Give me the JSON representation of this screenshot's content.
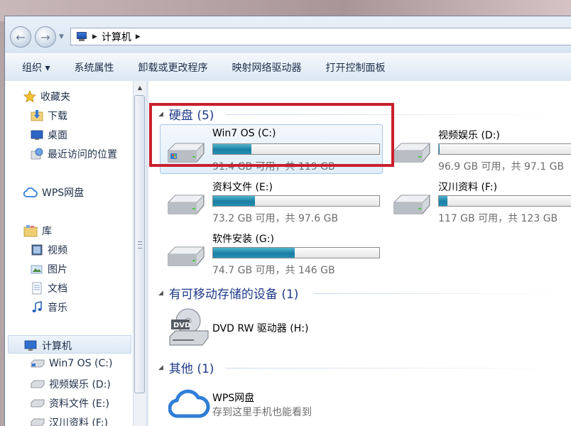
{
  "address": {
    "path": "计算机"
  },
  "toolbar": {
    "organize": "组织 ▾",
    "system_properties": "系统属性",
    "uninstall": "卸载或更改程序",
    "map_drive": "映射网络驱动器",
    "control_panel": "打开控制面板"
  },
  "nav": {
    "favorites": "收藏夹",
    "downloads": "下载",
    "desktop": "桌面",
    "recent": "最近访问的位置",
    "wps": "WPS网盘",
    "libraries": "库",
    "videos": "视频",
    "pictures": "图片",
    "documents": "文档",
    "music": "音乐",
    "computer": "计算机",
    "drive_c": "Win7 OS (C:)",
    "drive_d": "视频娱乐 (D:)",
    "drive_e": "资料文件 (E:)",
    "drive_f": "汉川资料 (F:)"
  },
  "groups": {
    "hdd": "硬盘 (5)",
    "removable": "有可移动存储的设备 (1)",
    "other": "其他 (1)"
  },
  "drives": [
    {
      "name": "Win7 OS (C:)",
      "free": "91.4 GB 可用，共 119 GB",
      "used_fraction": 0.23,
      "os": true
    },
    {
      "name": "视频娱乐 (D:)",
      "free": "96.9 GB 可用，共 97.1 GB",
      "used_fraction": 0.002,
      "os": false
    },
    {
      "name": "资料文件 (E:)",
      "free": "73.2 GB 可用，共 97.6 GB",
      "used_fraction": 0.25,
      "os": false
    },
    {
      "name": "汉川资料 (F:)",
      "free": "117 GB 可用，共 123 GB",
      "used_fraction": 0.05,
      "os": false
    },
    {
      "name": "软件安装 (G:)",
      "free": "74.7 GB 可用，共 146 GB",
      "used_fraction": 0.49,
      "os": false
    }
  ],
  "dvd": {
    "name": "DVD RW 驱动器 (H:)",
    "label": "DVD"
  },
  "wps_item": {
    "name": "WPS网盘",
    "desc": "存到这里手机也能看到"
  },
  "colors": {
    "highlight": "#c8202c",
    "bar_fill": "#1a7ea3",
    "group_heading": "#1e3a8a"
  }
}
